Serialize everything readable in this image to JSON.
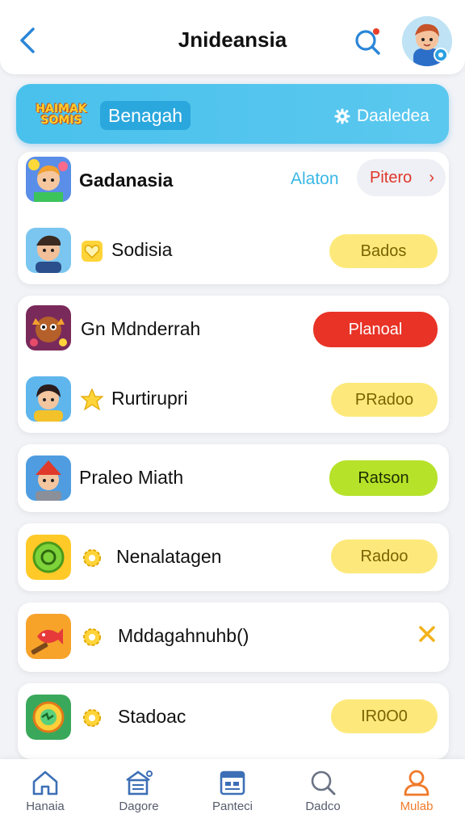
{
  "header": {
    "title": "Jnideansia"
  },
  "banner": {
    "logo_text": "HAIMAK SOMIS",
    "pill_label": "Benagah",
    "action_label": "Daaledea"
  },
  "cards": [
    {
      "rows": [
        {
          "title": "Gadanasia",
          "link_label": "Alaton",
          "chip_label": "Pitero",
          "icon": "boy-with-flowers-icon"
        },
        {
          "title": "Sodisia",
          "button_label": "Bados",
          "icon": "boy-portrait-icon",
          "sub_icon": "heart-badge-icon"
        }
      ]
    },
    {
      "rows": [
        {
          "title": "Gn Mdnderrah",
          "button_label": "Planoal",
          "icon": "monster-character-icon"
        },
        {
          "title": "Rurtirupri",
          "button_label": "PRadoo",
          "icon": "girl-portrait-icon",
          "sub_icon": "star-badge-icon"
        }
      ]
    },
    {
      "rows": [
        {
          "title": "Praleo Miath",
          "button_label": "Ratson",
          "icon": "knight-character-icon"
        }
      ]
    },
    {
      "rows": [
        {
          "title": "Nenalatagen",
          "button_label": "Radoo",
          "icon": "green-coin-icon",
          "sub_icon": "gear-badge-icon"
        }
      ]
    },
    {
      "rows": [
        {
          "title": "Mddagahnuhb()",
          "icon": "fish-hammer-icon",
          "sub_icon": "gear-badge-icon"
        }
      ]
    },
    {
      "rows": [
        {
          "title": "Stadoac",
          "button_label": "IR0O0",
          "icon": "compass-game-icon",
          "sub_icon": "gear-badge-icon"
        }
      ]
    }
  ],
  "nav": [
    {
      "label": "Hanaia",
      "icon": "home-icon"
    },
    {
      "label": "Dagore",
      "icon": "store-icon"
    },
    {
      "label": "Panteci",
      "icon": "calendar-icon"
    },
    {
      "label": "Dadco",
      "icon": "search-icon"
    },
    {
      "label": "Mulab",
      "icon": "profile-icon",
      "active": true
    }
  ],
  "colors": {
    "accent_blue": "#49c1ec",
    "pill_yellow": "#fde97b",
    "pill_red": "#e83326",
    "pill_green": "#b6e22a",
    "active_nav": "#f07a2a"
  }
}
